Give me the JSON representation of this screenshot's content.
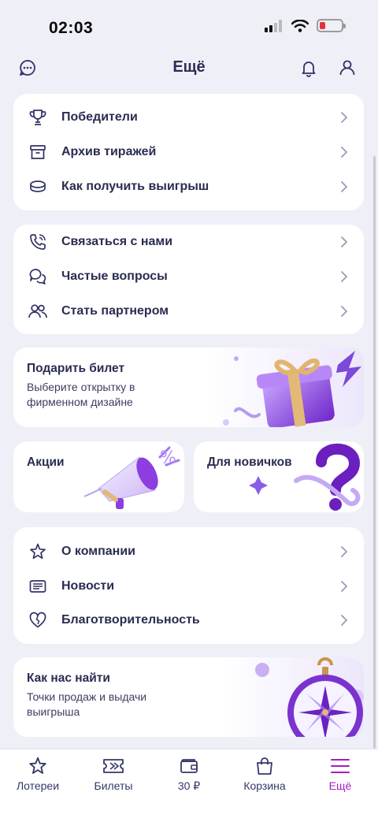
{
  "status": {
    "time": "02:03"
  },
  "header": {
    "title": "Ещё"
  },
  "menu_group_1": [
    {
      "label": "Победители",
      "icon": "trophy-icon"
    },
    {
      "label": "Архив тиражей",
      "icon": "archive-box-icon"
    },
    {
      "label": "Как получить выигрыш",
      "icon": "coins-icon"
    }
  ],
  "menu_group_2": [
    {
      "label": "Связаться с нами",
      "icon": "phone-icon"
    },
    {
      "label": "Частые вопросы",
      "icon": "chat-bubbles-icon"
    },
    {
      "label": "Стать партнером",
      "icon": "people-icon"
    }
  ],
  "gift": {
    "title": "Подарить билет",
    "subtitle": "Выберите открытку в фирменном дизайне"
  },
  "promos": {
    "label": "Акции"
  },
  "newbies": {
    "label": "Для новичков"
  },
  "menu_group_3": [
    {
      "label": "О компании",
      "icon": "star-icon"
    },
    {
      "label": "Новости",
      "icon": "newspaper-icon"
    },
    {
      "label": "Благотворительность",
      "icon": "heart-icon"
    }
  ],
  "find_us": {
    "title": "Как нас найти",
    "subtitle": "Точки продаж и выдачи выигрыша"
  },
  "tabbar": [
    {
      "label": "Лотереи",
      "icon": "star-icon"
    },
    {
      "label": "Билеты",
      "icon": "ticket-icon"
    },
    {
      "label": "30 ₽",
      "icon": "wallet-icon"
    },
    {
      "label": "Корзина",
      "icon": "shopping-bag-icon"
    },
    {
      "label": "Ещё",
      "icon": "menu-icon",
      "active": true
    }
  ],
  "colors": {
    "accent": "#a41ec0",
    "primary_text": "#2a2c52",
    "background": "#efeff8"
  }
}
